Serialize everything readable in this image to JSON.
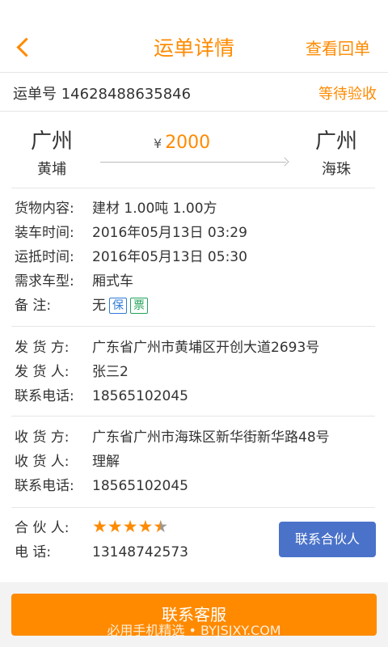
{
  "header": {
    "title": "运单详情",
    "right_action": "查看回单"
  },
  "order": {
    "number_label": "运单号 14628488635846",
    "status": "等待验收"
  },
  "route": {
    "from_city": "广州",
    "from_district": "黄埔",
    "to_city": "广州",
    "to_district": "海珠",
    "currency": "¥",
    "price": "2000"
  },
  "cargo": [
    {
      "label": "货物内容:",
      "value": "建材   1.00吨   1.00方"
    },
    {
      "label": "装车时间:",
      "value": "2016年05月13日 03:29"
    },
    {
      "label": "运抵时间:",
      "value": "2016年05月13日 05:30"
    },
    {
      "label": "需求车型:",
      "value": "厢式车"
    },
    {
      "label": "备      注:",
      "value": "无"
    }
  ],
  "badges": {
    "bao": "保",
    "piao": "票"
  },
  "shipper": [
    {
      "label": "发  货  方:",
      "value": "广东省广州市黄埔区开创大道2693号"
    },
    {
      "label": "发  货  人:",
      "value": "张三2"
    },
    {
      "label": "联系电话:",
      "value": "18565102045"
    }
  ],
  "receiver": [
    {
      "label": "收  货  方:",
      "value": "广东省广州市海珠区新华街新华路48号"
    },
    {
      "label": "收  货  人:",
      "value": "理解"
    },
    {
      "label": "联系电话:",
      "value": "18565102045"
    }
  ],
  "partner": {
    "label": "合  伙  人:",
    "rating": 4.5,
    "phone_label": "电      话:",
    "phone": "13148742573",
    "contact_button": "联系合伙人"
  },
  "footer": {
    "service_button": "联系客服",
    "watermark": "必用手机精选 • BYJSJXY.COM"
  },
  "colors": {
    "accent": "#ff8a00",
    "partner_button": "#4a72c9"
  }
}
